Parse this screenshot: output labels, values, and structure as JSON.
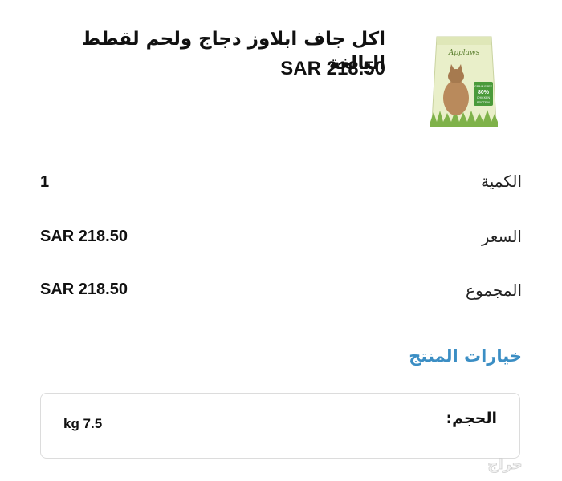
{
  "product": {
    "title": "اكل جاف ابلاوز دجاج ولحم لقطط البالغة",
    "price": "SAR 218.50",
    "image": {
      "icon": "cat-food-bag-image",
      "brand": "Applaws",
      "badge_line1": "GRAIN FREE",
      "badge_line2": "80%",
      "badge_line3": "CHICKEN",
      "badge_line4": "PROTEIN"
    }
  },
  "summary": {
    "quantity_label": "الكمية",
    "quantity_value": "1",
    "price_label": "السعر",
    "price_value": "SAR 218.50",
    "total_label": "المجموع",
    "total_value": "SAR 218.50"
  },
  "options": {
    "heading": "خيارات المنتج",
    "size_label": "الحجم:",
    "size_value": "kg 7.5"
  },
  "watermark": {
    "text": "حراج"
  },
  "colors": {
    "accent": "#3b8ec4",
    "text": "#111111",
    "card_border": "#dcdcdc"
  }
}
